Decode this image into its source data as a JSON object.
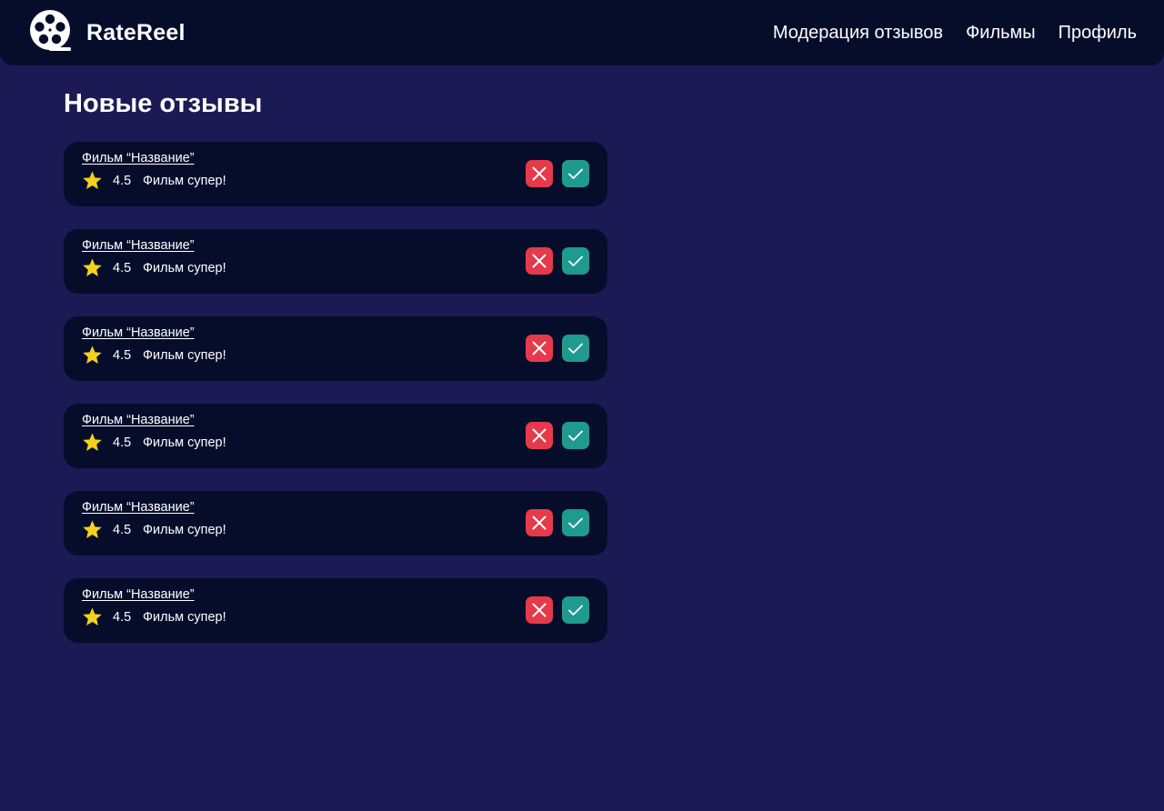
{
  "header": {
    "brand": "RateReel",
    "nav": [
      {
        "label": "Модерация отзывов"
      },
      {
        "label": "Фильмы"
      },
      {
        "label": "Профиль"
      }
    ]
  },
  "page": {
    "title": "Новые отзывы"
  },
  "colors": {
    "background": "#1c1a55",
    "card": "#060d2b",
    "reject": "#e53a4b",
    "approve": "#1f9a8f",
    "star": "#f2d21b"
  },
  "reviews": [
    {
      "film": "Фильм “Название”",
      "rating": "4.5",
      "text": "Фильм супер!"
    },
    {
      "film": "Фильм “Название”",
      "rating": "4.5",
      "text": "Фильм супер!"
    },
    {
      "film": "Фильм “Название”",
      "rating": "4.5",
      "text": "Фильм супер!"
    },
    {
      "film": "Фильм “Название”",
      "rating": "4.5",
      "text": "Фильм супер!"
    },
    {
      "film": "Фильм “Название”",
      "rating": "4.5",
      "text": "Фильм супер!"
    },
    {
      "film": "Фильм “Название”",
      "rating": "4.5",
      "text": "Фильм супер!"
    }
  ],
  "icons": {
    "logo": "film-reel-icon",
    "rating": "star-icon",
    "reject": "close-icon",
    "approve": "check-icon"
  }
}
